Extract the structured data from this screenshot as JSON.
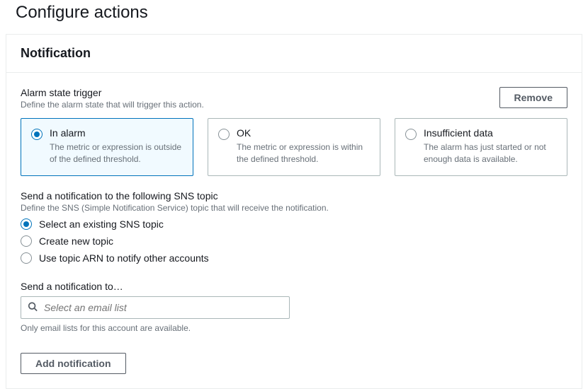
{
  "page_title": "Configure actions",
  "panel": {
    "title": "Notification",
    "remove_button": "Remove",
    "trigger": {
      "title": "Alarm state trigger",
      "description": "Define the alarm state that will trigger this action.",
      "options": [
        {
          "label": "In alarm",
          "description": "The metric or expression is outside of the defined threshold.",
          "selected": true
        },
        {
          "label": "OK",
          "description": "The metric or expression is within the defined threshold.",
          "selected": false
        },
        {
          "label": "Insufficient data",
          "description": "The alarm has just started or not enough data is available.",
          "selected": false
        }
      ]
    },
    "sns": {
      "title": "Send a notification to the following SNS topic",
      "description": "Define the SNS (Simple Notification Service) topic that will receive the notification.",
      "options": [
        {
          "label": "Select an existing SNS topic",
          "selected": true
        },
        {
          "label": "Create new topic",
          "selected": false
        },
        {
          "label": "Use topic ARN to notify other accounts",
          "selected": false
        }
      ]
    },
    "send_to": {
      "label": "Send a notification to…",
      "placeholder": "Select an email list",
      "hint": "Only email lists for this account are available."
    },
    "add_button": "Add notification"
  }
}
